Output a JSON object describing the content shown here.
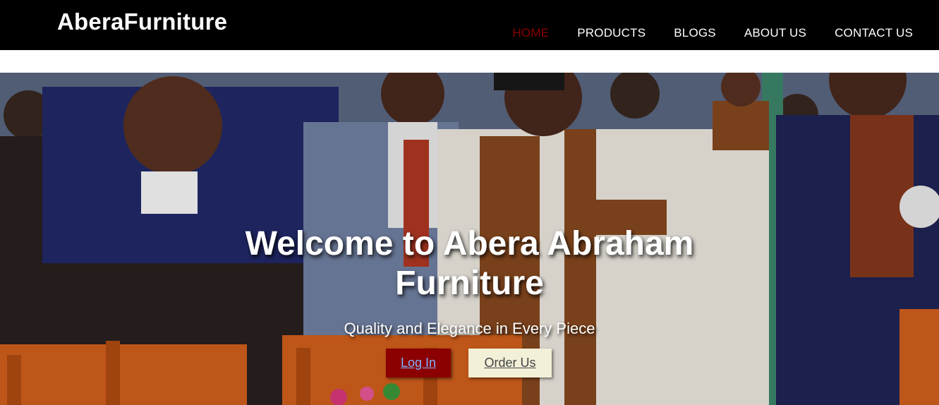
{
  "brand": "AberaFurniture",
  "nav": {
    "items": [
      "HOME",
      "PRODUCTS",
      "BLOGS",
      "ABOUT US",
      "CONTACT US"
    ],
    "active_color": "#8b0000"
  },
  "hero": {
    "title": "Welcome to Abera Abraham Furniture",
    "subtitle": "Quality and Elegance in Every Piece",
    "login_label": "Log In",
    "order_label": "Order Us"
  }
}
